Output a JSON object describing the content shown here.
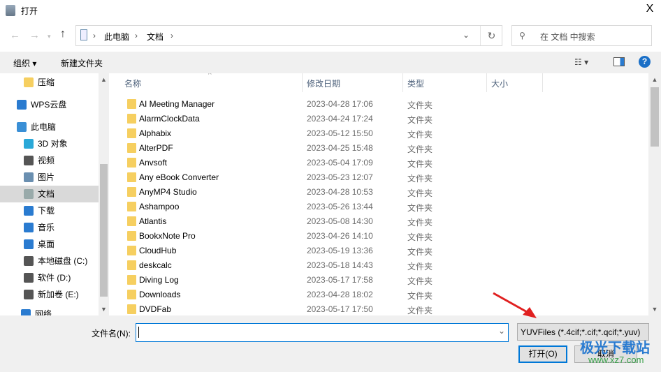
{
  "window": {
    "title": "打开",
    "close": "X"
  },
  "address": {
    "crumbs": [
      "此电脑",
      "文档"
    ],
    "sep": "›",
    "search_placeholder": "在 文档 中搜索"
  },
  "toolbar": {
    "organize": "组织 ▾",
    "new_folder": "新建文件夹",
    "view": "☷ ▾",
    "help": "?"
  },
  "nav": [
    {
      "label": "压缩",
      "icon": "folder-icon",
      "color": "#f6cf60"
    },
    {
      "label": "WPS云盘",
      "icon": "cloud-icon",
      "color": "#2a7bd0"
    },
    {
      "label": "此电脑",
      "icon": "computer-icon",
      "color": "#3a8fd6"
    },
    {
      "label": "3D 对象",
      "icon": "cube-icon",
      "color": "#2aa8d8"
    },
    {
      "label": "视频",
      "icon": "video-icon",
      "color": "#555"
    },
    {
      "label": "图片",
      "icon": "picture-icon",
      "color": "#6a8fb0"
    },
    {
      "label": "文档",
      "icon": "document-icon",
      "color": "#9aa"
    },
    {
      "label": "下载",
      "icon": "download-icon",
      "color": "#2a7bd0"
    },
    {
      "label": "音乐",
      "icon": "music-icon",
      "color": "#2a7bd0"
    },
    {
      "label": "桌面",
      "icon": "desktop-icon",
      "color": "#2a7bd0"
    },
    {
      "label": "本地磁盘 (C:)",
      "icon": "drive-icon",
      "color": "#555"
    },
    {
      "label": "软件 (D:)",
      "icon": "drive-icon",
      "color": "#555"
    },
    {
      "label": "新加卷 (E:)",
      "icon": "drive-icon",
      "color": "#555"
    },
    {
      "label": "网络",
      "icon": "network-icon",
      "color": "#2a7bd0"
    }
  ],
  "columns": {
    "name": "名称",
    "date": "修改日期",
    "type": "类型",
    "size": "大小"
  },
  "files": [
    {
      "name": "AI Meeting Manager",
      "date": "2023-04-28 17:06",
      "type": "文件夹"
    },
    {
      "name": "AlarmClockData",
      "date": "2023-04-24 17:24",
      "type": "文件夹"
    },
    {
      "name": "Alphabix",
      "date": "2023-05-12 15:50",
      "type": "文件夹"
    },
    {
      "name": "AlterPDF",
      "date": "2023-04-25 15:48",
      "type": "文件夹"
    },
    {
      "name": "Anvsoft",
      "date": "2023-05-04 17:09",
      "type": "文件夹"
    },
    {
      "name": "Any eBook Converter",
      "date": "2023-05-23 12:07",
      "type": "文件夹"
    },
    {
      "name": "AnyMP4 Studio",
      "date": "2023-04-28 10:53",
      "type": "文件夹"
    },
    {
      "name": "Ashampoo",
      "date": "2023-05-26 13:44",
      "type": "文件夹"
    },
    {
      "name": "Atlantis",
      "date": "2023-05-08 14:30",
      "type": "文件夹"
    },
    {
      "name": "BookxNote Pro",
      "date": "2023-04-26 14:10",
      "type": "文件夹"
    },
    {
      "name": "CloudHub",
      "date": "2023-05-19 13:36",
      "type": "文件夹"
    },
    {
      "name": "deskcalc",
      "date": "2023-05-18 14:43",
      "type": "文件夹"
    },
    {
      "name": "Diving Log",
      "date": "2023-05-17 17:58",
      "type": "文件夹"
    },
    {
      "name": "Downloads",
      "date": "2023-04-28 18:02",
      "type": "文件夹"
    },
    {
      "name": "DVDFab",
      "date": "2023-05-17 17:50",
      "type": "文件夹"
    }
  ],
  "bottom": {
    "filename_label": "文件名(N):",
    "filename_value": "",
    "filter": "YUVFiles (*.4cif;*.cif;*.qcif;*.yuv)",
    "open": "打开(O)",
    "cancel": "取消"
  },
  "watermark": {
    "text": "极光下载站",
    "url": "www.xz7.com"
  }
}
